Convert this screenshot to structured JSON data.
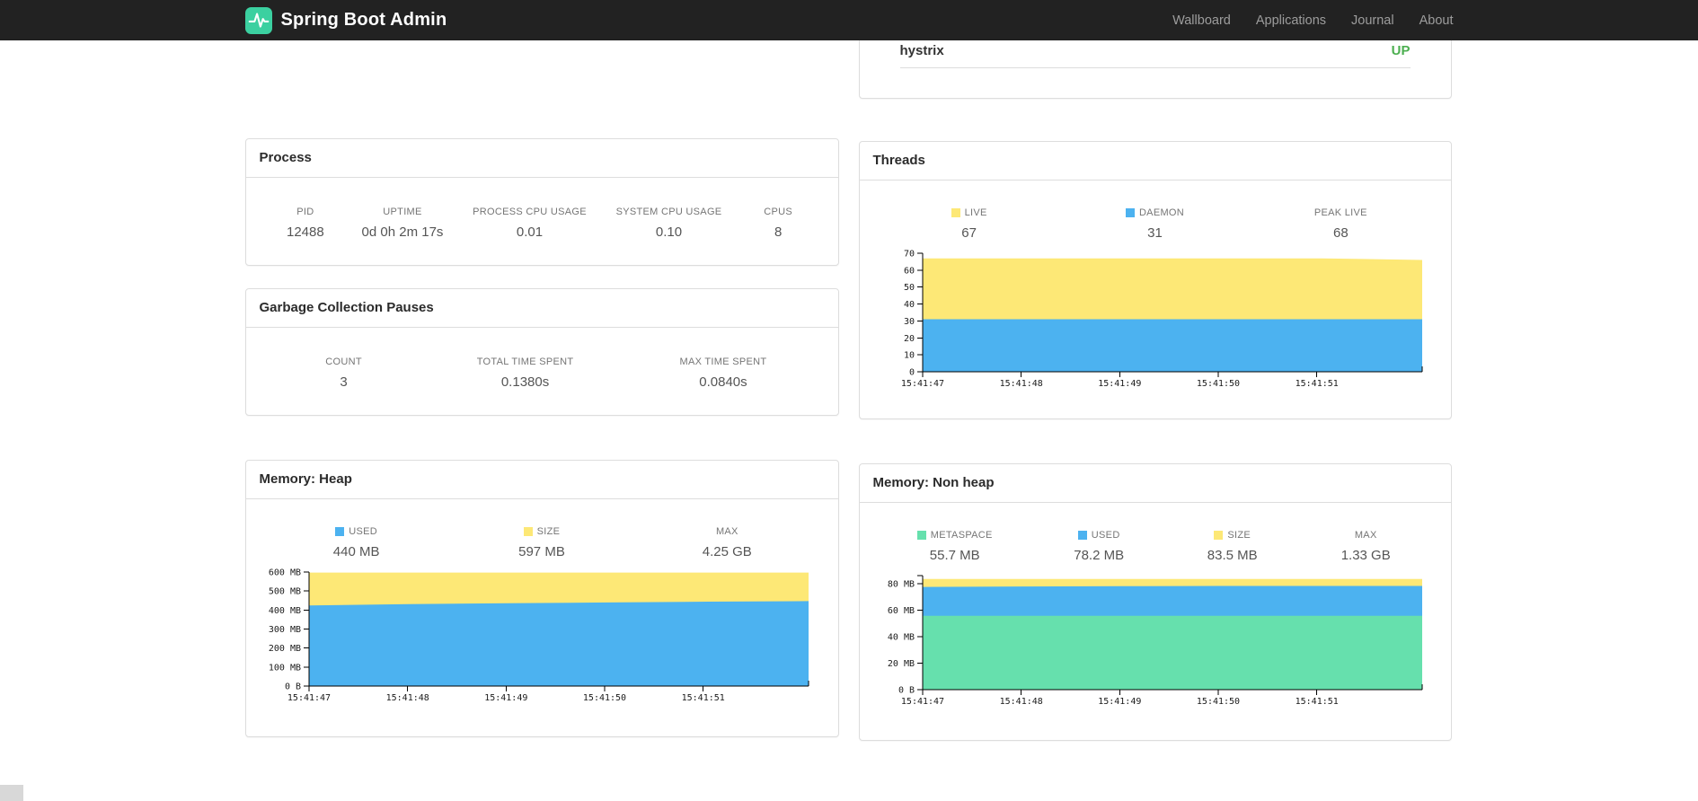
{
  "navbar": {
    "brand": "Spring Boot Admin",
    "links": [
      {
        "label": "Wallboard"
      },
      {
        "label": "Applications"
      },
      {
        "label": "Journal"
      },
      {
        "label": "About"
      }
    ],
    "brand_color": "#3bd0a0",
    "bar_color": "#222222"
  },
  "application_row": {
    "name": "hystrix",
    "status": "UP",
    "status_color": "#4caf50"
  },
  "panels": {
    "process": {
      "title": "Process",
      "metrics": [
        {
          "label": "PID",
          "value": "12488"
        },
        {
          "label": "UPTIME",
          "value": "0d 0h 2m 17s"
        },
        {
          "label": "PROCESS CPU USAGE",
          "value": "0.01"
        },
        {
          "label": "SYSTEM CPU USAGE",
          "value": "0.10"
        },
        {
          "label": "CPUS",
          "value": "8"
        }
      ]
    },
    "gc": {
      "title": "Garbage Collection Pauses",
      "metrics": [
        {
          "label": "COUNT",
          "value": "3"
        },
        {
          "label": "TOTAL TIME SPENT",
          "value": "0.1380s"
        },
        {
          "label": "MAX TIME SPENT",
          "value": "0.0840s"
        }
      ]
    },
    "threads": {
      "metrics": [
        {
          "label": "LIVE",
          "value": "67",
          "color": "#fde876"
        },
        {
          "label": "DAEMON",
          "value": "31",
          "color": "#4cb2f0"
        },
        {
          "label": "PEAK LIVE",
          "value": "68"
        }
      ]
    },
    "heap": {
      "metrics": [
        {
          "label": "USED",
          "value": "440 MB",
          "color": "#4cb2f0"
        },
        {
          "label": "SIZE",
          "value": "597 MB",
          "color": "#fde876"
        },
        {
          "label": "MAX",
          "value": "4.25 GB"
        }
      ]
    },
    "nonheap": {
      "metrics": [
        {
          "label": "METASPACE",
          "value": "55.7 MB",
          "color": "#66e0ad"
        },
        {
          "label": "USED",
          "value": "78.2 MB",
          "color": "#4cb2f0"
        },
        {
          "label": "SIZE",
          "value": "83.5 MB",
          "color": "#fde876"
        },
        {
          "label": "MAX",
          "value": "1.33 GB"
        }
      ]
    }
  },
  "chart_data": [
    {
      "type": "area",
      "title": "Threads",
      "stacked": true,
      "values_are_stack_tops": true,
      "x_tick_labels": [
        "15:41:47",
        "15:41:48",
        "15:41:49",
        "15:41:50",
        "15:41:51"
      ],
      "ylim": [
        0,
        70
      ],
      "y_ticks": [
        {
          "v": 0,
          "label": "0"
        },
        {
          "v": 10,
          "label": "10"
        },
        {
          "v": 20,
          "label": "20"
        },
        {
          "v": 30,
          "label": "30"
        },
        {
          "v": 40,
          "label": "40"
        },
        {
          "v": 50,
          "label": "50"
        },
        {
          "v": 60,
          "label": "60"
        },
        {
          "v": 70,
          "label": "70"
        }
      ],
      "series": [
        {
          "name": "DAEMON",
          "color": "#4cb2f0",
          "values": [
            31,
            31,
            31,
            31,
            31,
            31
          ]
        },
        {
          "name": "LIVE",
          "color": "#fde876",
          "values": [
            67,
            67,
            67,
            67,
            67,
            66
          ]
        }
      ]
    },
    {
      "type": "area",
      "title": "Memory: Heap",
      "stacked": true,
      "values_are_stack_tops": true,
      "x_tick_labels": [
        "15:41:47",
        "15:41:48",
        "15:41:49",
        "15:41:50",
        "15:41:51"
      ],
      "ylim": [
        0,
        600
      ],
      "y_ticks": [
        {
          "v": 0,
          "label": "0 B"
        },
        {
          "v": 100,
          "label": "100 MB"
        },
        {
          "v": 200,
          "label": "200 MB"
        },
        {
          "v": 300,
          "label": "300 MB"
        },
        {
          "v": 400,
          "label": "400 MB"
        },
        {
          "v": 500,
          "label": "500 MB"
        },
        {
          "v": 600,
          "label": "600 MB"
        }
      ],
      "series": [
        {
          "name": "USED",
          "color": "#4cb2f0",
          "values": [
            424,
            431,
            436,
            440,
            444,
            447
          ]
        },
        {
          "name": "SIZE",
          "color": "#fde876",
          "values": [
            597,
            597,
            597,
            597,
            597,
            597
          ]
        }
      ]
    },
    {
      "type": "area",
      "title": "Memory: Non heap",
      "stacked": true,
      "values_are_stack_tops": true,
      "x_tick_labels": [
        "15:41:47",
        "15:41:48",
        "15:41:49",
        "15:41:50",
        "15:41:51"
      ],
      "ylim": [
        0,
        86
      ],
      "y_ticks": [
        {
          "v": 0,
          "label": "0 B"
        },
        {
          "v": 20,
          "label": "20 MB"
        },
        {
          "v": 40,
          "label": "40 MB"
        },
        {
          "v": 60,
          "label": "60 MB"
        },
        {
          "v": 80,
          "label": "80 MB"
        }
      ],
      "series": [
        {
          "name": "METASPACE",
          "color": "#66e0ad",
          "values": [
            55.7,
            55.7,
            55.7,
            55.7,
            55.7,
            55.7
          ]
        },
        {
          "name": "USED",
          "color": "#4cb2f0",
          "values": [
            77.5,
            77.8,
            78.0,
            78.2,
            78.2,
            78.2
          ]
        },
        {
          "name": "SIZE",
          "color": "#fde876",
          "values": [
            83.5,
            83.5,
            83.5,
            83.5,
            83.5,
            83.5
          ]
        }
      ]
    }
  ]
}
